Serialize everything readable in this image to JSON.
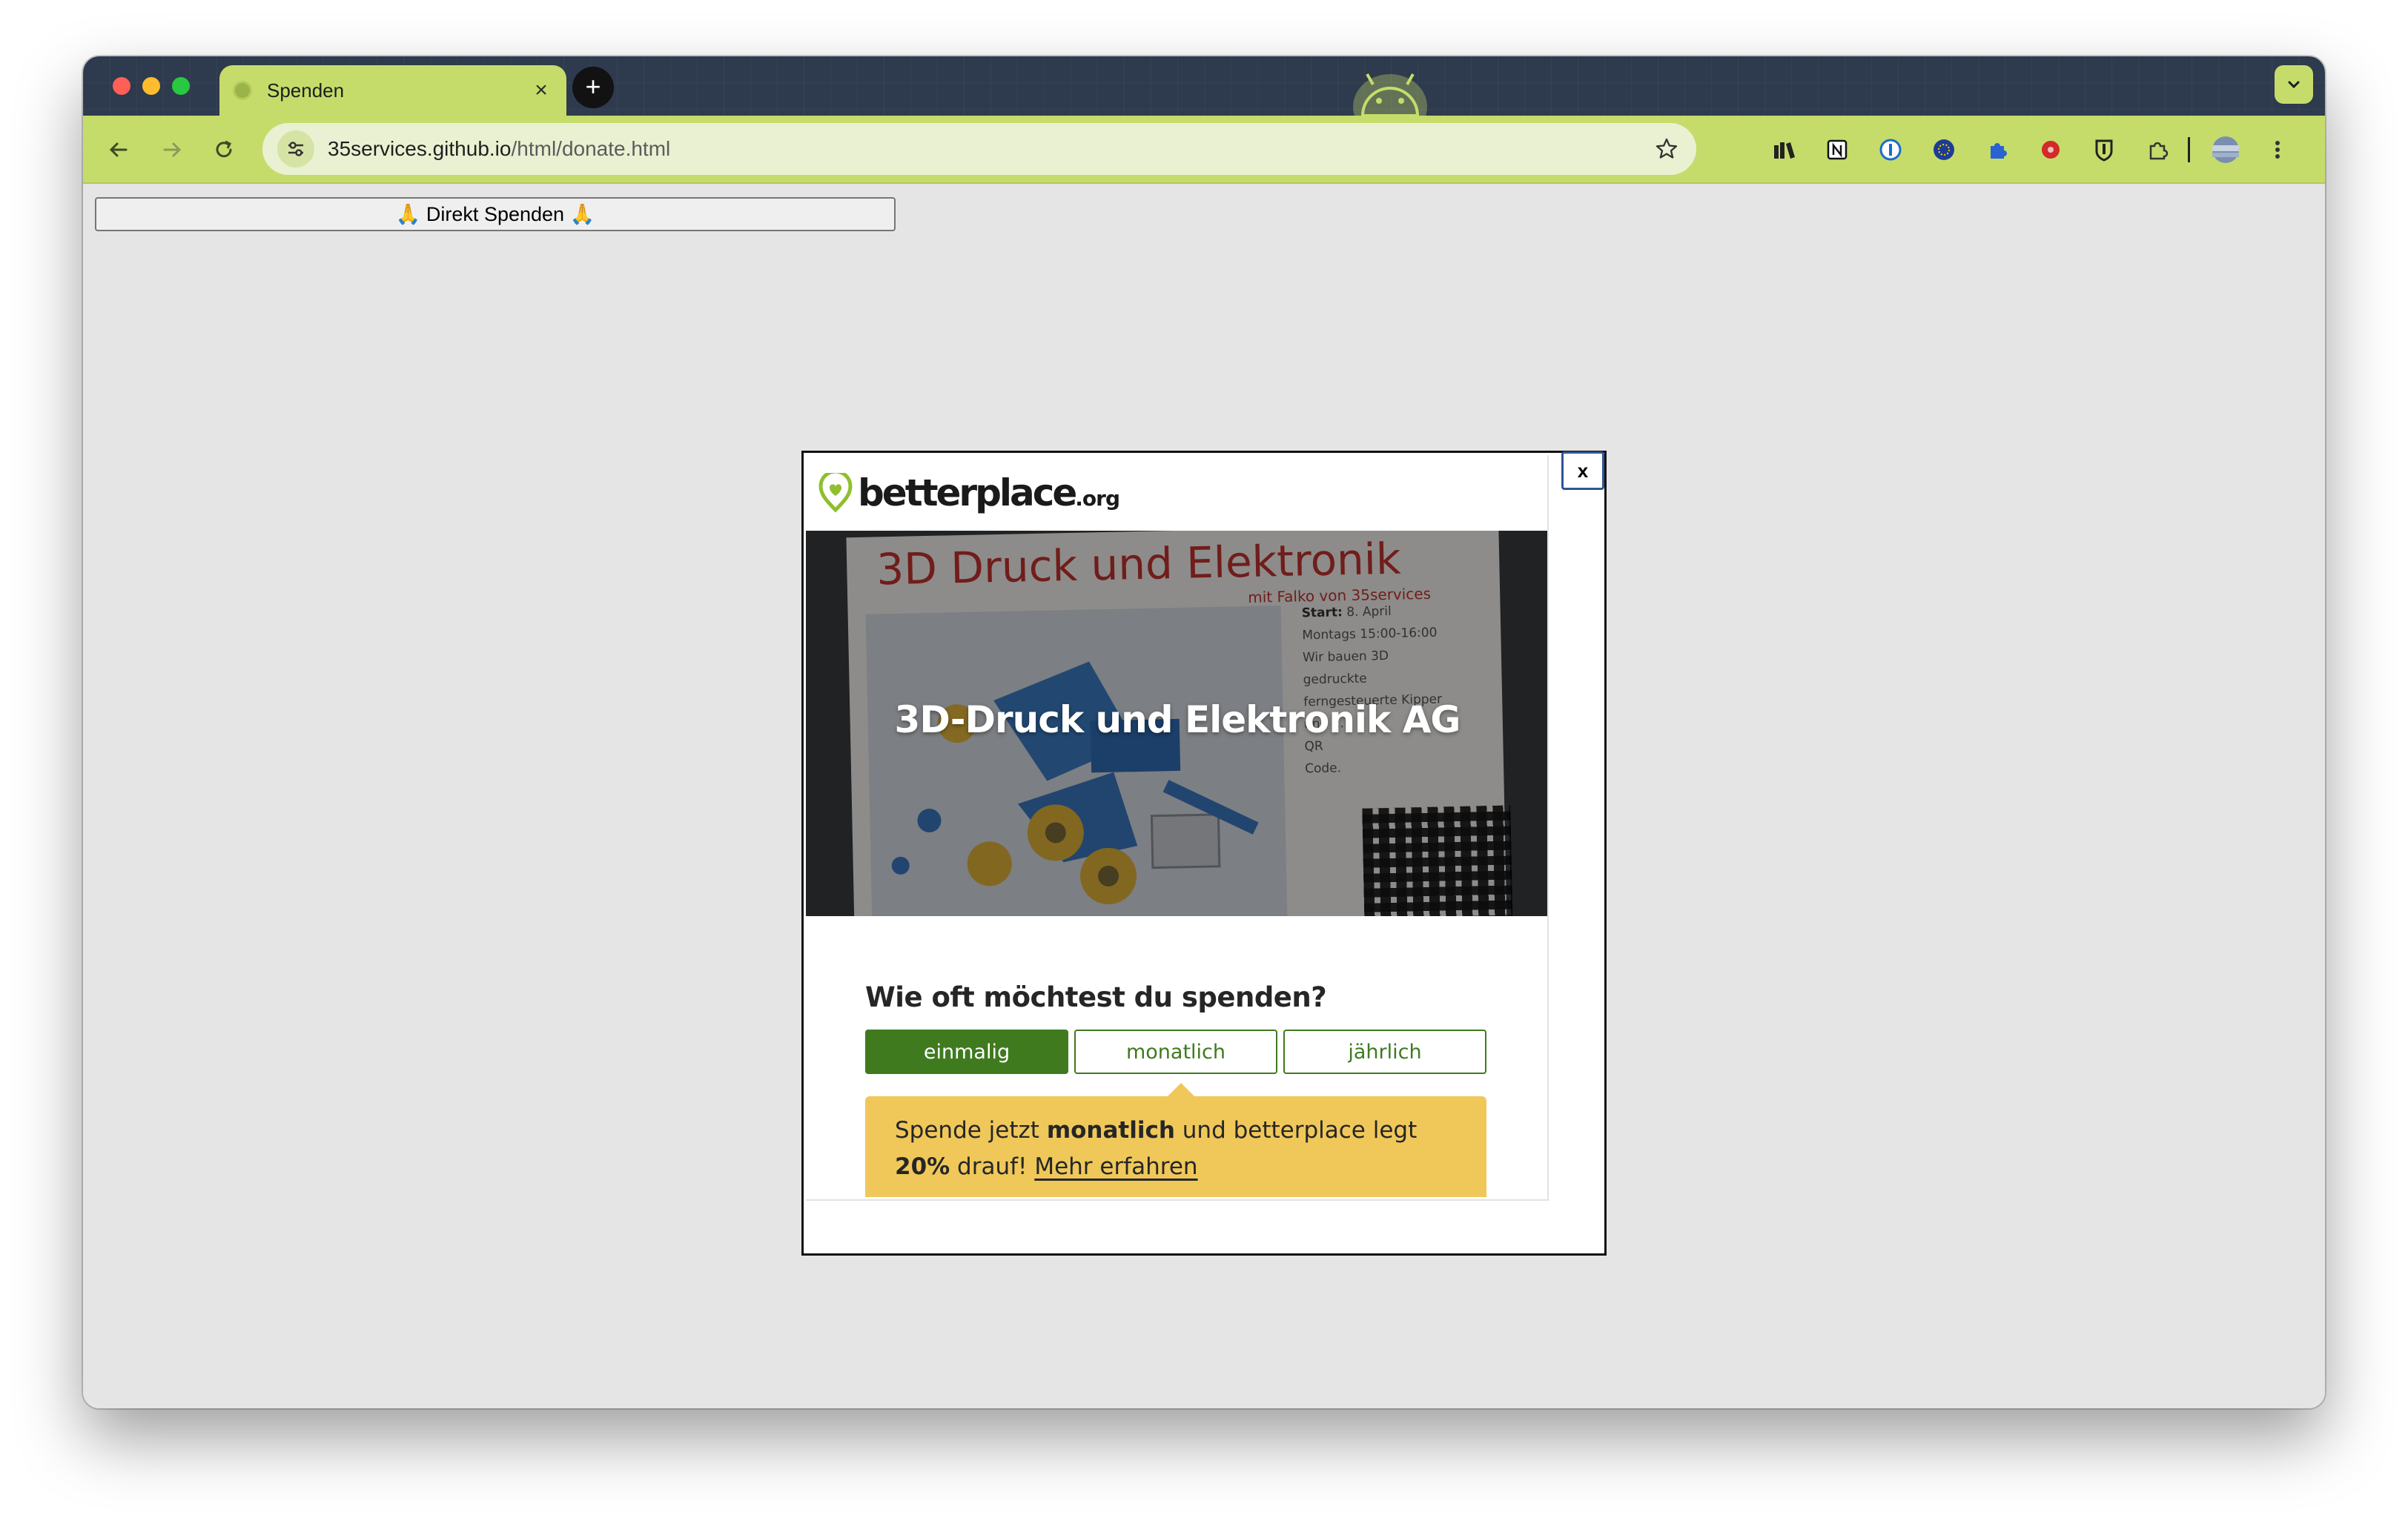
{
  "browser": {
    "tab_title": "Spenden",
    "tab_close": "×",
    "new_tab": "+",
    "url_host": "35services.github.io",
    "url_path": "/html/donate.html",
    "accent": "#c5dc6a"
  },
  "page": {
    "direct_button": "🙏 Direkt Spenden 🙏"
  },
  "modal": {
    "close_label": "x",
    "logo_main": "betterplace",
    "logo_suffix": ".org",
    "hero_title": "3D-Druck und Elektronik AG",
    "poster": {
      "title": "3D Druck und Elektronik",
      "subtitle": "mit Falko von 35services",
      "start_label": "Start:",
      "start_value": "8. April",
      "lines": [
        "Montags 15:00-16:00",
        "Wir bauen 3D",
        "gedruckte",
        "ferngesteuerte Kipper",
        "und ...",
        "QR",
        "Code."
      ]
    },
    "question": "Wie oft möchtest du spenden?",
    "frequencies": [
      "einmalig",
      "monatlich",
      "jährlich"
    ],
    "selected_frequency": "einmalig",
    "promo": {
      "text_1": "Spende jetzt ",
      "bold_1": "monatlich",
      "text_2": " und betterplace legt ",
      "bold_2": "20%",
      "text_3": " drauf! ",
      "link": "Mehr erfahren"
    },
    "colors": {
      "brand_green": "#3f7a1f",
      "promo_yellow": "#f0c85a"
    }
  }
}
